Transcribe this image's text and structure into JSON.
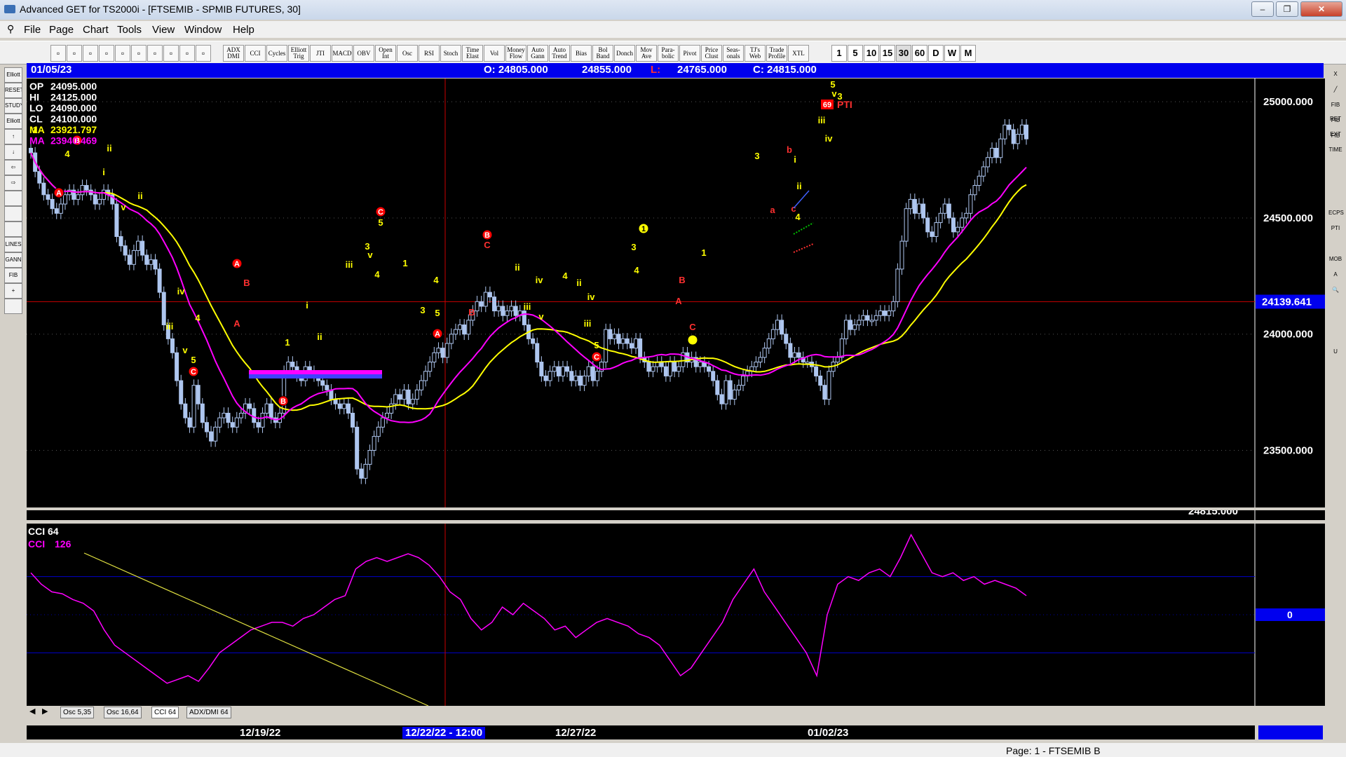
{
  "window": {
    "title": "Advanced GET for TS2000i - [FTSEMIB - SPMIB FUTURES, 30]",
    "min": "–",
    "max": "❐",
    "close": "✕"
  },
  "menu": [
    "File",
    "Page",
    "Chart",
    "Tools",
    "View",
    "Window",
    "Help"
  ],
  "mdi": [
    "-",
    "▫",
    "x"
  ],
  "toolbar": {
    "studies": [
      "ADX DMI",
      "CCI",
      "Cycles",
      "Elliott Trig",
      "JTI",
      "MACD",
      "OBV",
      "Open Int",
      "Osc",
      "RSI",
      "Stoch",
      "Time Elast",
      "Vol",
      "Money Flow",
      "Auto Gann",
      "Auto Trend",
      "Bias",
      "Bol Band",
      "Donch",
      "Mov Ave",
      "Para-bolic",
      "Pivot",
      "Price Clust",
      "Seas-onals",
      "TJ's Web",
      "Trade Profile",
      "XTL"
    ],
    "timeframes": [
      "1",
      "5",
      "10",
      "15",
      "30",
      "60",
      "D",
      "W",
      "M"
    ],
    "selected_timeframe": "30"
  },
  "left_tools": [
    "Elliott",
    "RESET",
    "STUDY",
    "Elliott",
    "↑",
    "↓",
    "⇦",
    "⇨",
    "",
    "",
    "",
    "LINES",
    "GANN",
    "FIB",
    "+",
    ""
  ],
  "right_tools": [
    "X",
    "╱",
    "FIB RET",
    "FIB EXT",
    "FIB TIME",
    "",
    "",
    "",
    "",
    "ECPS",
    "PTI",
    "",
    "MOB",
    "A",
    "🔍",
    "",
    "",
    "",
    "U"
  ],
  "price_bar": {
    "date": "01/05/23",
    "open": "O: 24805.000",
    "high": "24855.000",
    "low_label": "L:",
    "low": "24765.000",
    "close": "C: 24815.000"
  },
  "readout": [
    {
      "label": "OP",
      "value": "24095.000",
      "color": "#ffffff"
    },
    {
      "label": "HI",
      "value": "24125.000",
      "color": "#ffffff"
    },
    {
      "label": "LO",
      "value": "24090.000",
      "color": "#ffffff"
    },
    {
      "label": "CL",
      "value": "24100.000",
      "color": "#ffffff"
    },
    {
      "label": "MA",
      "value": "23921.797",
      "color": "#ffff00"
    },
    {
      "label": "MA",
      "value": "23940.469",
      "color": "#ff00ff"
    }
  ],
  "price_axis": {
    "ticks": [
      "25000.000",
      "24500.000",
      "24000.000",
      "23500.000"
    ],
    "crosshair": "24139.641",
    "last": "24815.000",
    "pti": "69",
    "pti_label": "PTI"
  },
  "cci_panel": {
    "title": "CCI 64",
    "value_label": "CCI",
    "value": "126",
    "zero": "0"
  },
  "tabs": [
    "Osc 5,35",
    "Osc 16,64",
    "CCI 64",
    "ADX/DMI 64"
  ],
  "selected_tab": "CCI 64",
  "dates": [
    "12/19/22",
    "12/22/22 - 12:00",
    "12/27/22",
    "01/02/23"
  ],
  "status": "Page: 1 - FTSEMIB B",
  "colors": {
    "up": "#aec6ef",
    "ma_fast": "#ffff00",
    "ma_slow": "#ff00ff",
    "wave_red": "#ff0000",
    "wave_yellow": "#ffff00",
    "crosshair": "#cc0000",
    "axis_blue": "#0000ee"
  },
  "chart_data": {
    "type": "candlestick",
    "title": "FTSEMIB - SPMIB FUTURES, 30",
    "y_range": [
      23200,
      25100
    ],
    "closes": [
      24780,
      24700,
      24650,
      24600,
      24580,
      24540,
      24520,
      24560,
      24600,
      24620,
      24580,
      24600,
      24640,
      24620,
      24600,
      24560,
      24580,
      24620,
      24600,
      24560,
      24420,
      24380,
      24340,
      24300,
      24360,
      24400,
      24340,
      24300,
      24320,
      24280,
      24180,
      24040,
      23980,
      23920,
      23800,
      23700,
      23640,
      23600,
      23780,
      23700,
      23620,
      23580,
      23540,
      23600,
      23640,
      23660,
      23620,
      23600,
      23640,
      23660,
      23700,
      23680,
      23620,
      23600,
      23660,
      23700,
      23640,
      23620,
      23660,
      23840,
      23880,
      23860,
      23820,
      23800,
      23860,
      23840,
      23820,
      23800,
      23780,
      23760,
      23720,
      23700,
      23680,
      23700,
      23660,
      23600,
      23420,
      23380,
      23440,
      23500,
      23560,
      23600,
      23640,
      23660,
      23700,
      23740,
      23720,
      23760,
      23700,
      23720,
      23760,
      23800,
      23840,
      23880,
      23920,
      23940,
      23900,
      23960,
      24000,
      24020,
      24040,
      24000,
      24060,
      24100,
      24140,
      24120,
      24180,
      24160,
      24100,
      24120,
      24080,
      24100,
      24120,
      24080,
      24100,
      24040,
      23980,
      23960,
      23880,
      23820,
      23800,
      23840,
      23860,
      23820,
      23860,
      23840,
      23800,
      23820,
      23780,
      23820,
      23860,
      23800,
      23840,
      23880,
      24020,
      23980,
      24000,
      23960,
      23980,
      23960,
      23940,
      23980,
      23900,
      23880,
      23840,
      23860,
      23880,
      23860,
      23820,
      23880,
      23840,
      23860,
      23920,
      23880,
      23900,
      23860,
      23880,
      23860,
      23840,
      23800,
      23740,
      23700,
      23800,
      23720,
      23760,
      23780,
      23820,
      23840,
      23860,
      23880,
      23900,
      23940,
      23980,
      24020,
      24060,
      24000,
      23960,
      23900,
      23920,
      23900,
      23880,
      23880,
      23860,
      23820,
      23780,
      23720,
      23840,
      23880,
      23900,
      23980,
      24060,
      24020,
      24040,
      24060,
      24080,
      24060,
      24060,
      24080,
      24100,
      24080,
      24100,
      24140,
      24280,
      24400,
      24540,
      24580,
      24520,
      24560,
      24500,
      24440,
      24420,
      24480,
      24520,
      24560,
      24500,
      24440,
      24460,
      24500,
      24520,
      24600,
      24640,
      24680,
      24720,
      24760,
      24800,
      24760,
      24840,
      24900,
      24880,
      24820,
      24860,
      24900,
      24840
    ],
    "wave_labels": [
      "1",
      "3",
      "4",
      "5",
      "i",
      "ii",
      "iii",
      "iv",
      "v",
      "A",
      "B",
      "C",
      "a",
      "b",
      "c"
    ],
    "cci_values": [
      110,
      80,
      60,
      55,
      40,
      30,
      10,
      -40,
      -80,
      -100,
      -120,
      -140,
      -160,
      -180,
      -170,
      -160,
      -175,
      -140,
      -100,
      -80,
      -60,
      -40,
      -30,
      -20,
      -20,
      -30,
      -10,
      0,
      20,
      40,
      50,
      120,
      140,
      150,
      140,
      150,
      160,
      150,
      130,
      100,
      60,
      40,
      -10,
      -40,
      -20,
      20,
      0,
      30,
      10,
      -10,
      -40,
      -30,
      -60,
      -40,
      -20,
      -10,
      -20,
      -30,
      -50,
      -60,
      -80,
      -120,
      -160,
      -140,
      -100,
      -60,
      -20,
      40,
      80,
      120,
      60,
      20,
      -20,
      -60,
      -100,
      -160,
      0,
      80,
      100,
      90,
      110,
      120,
      100,
      150,
      210,
      160,
      110,
      100,
      110,
      90,
      100,
      80,
      90,
      80,
      70,
      50
    ]
  }
}
